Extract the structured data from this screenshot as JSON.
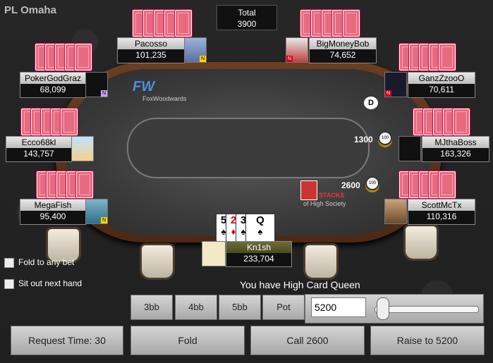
{
  "game": {
    "title": "PL Omaha"
  },
  "pot": {
    "label": "Total",
    "amount": "3900"
  },
  "players": {
    "pacosso": {
      "name": "Pacosso",
      "stack": "101,235"
    },
    "bigmoneybob": {
      "name": "BigMoneyBob",
      "stack": "74,652"
    },
    "pokergodgraz": {
      "name": "PokerGodGraz",
      "stack": "68,099"
    },
    "ganzzzooo": {
      "name": "GanzZzooO",
      "stack": "70,611"
    },
    "ecco68kl": {
      "name": "Ecco68kl",
      "stack": "143,757"
    },
    "mjthaboss": {
      "name": "MJthaBoss",
      "stack": "163,326"
    },
    "megafish": {
      "name": "MegaFish",
      "stack": "95,400"
    },
    "scottmctx": {
      "name": "ScottMcTx",
      "stack": "110,316"
    },
    "hero": {
      "name": "Kn1sh",
      "stack": "233,704"
    }
  },
  "badges": {
    "n": "N"
  },
  "bets": {
    "mjthaboss": "1300",
    "scottmctx": "2600",
    "chip_label": "100"
  },
  "dealer_button": "D",
  "table_logo": {
    "brand": "FW",
    "text": "FoxWoodwards"
  },
  "society_logo": {
    "word": "STACKS",
    "sub": "of High Society"
  },
  "hero_cards": [
    {
      "rank": "5",
      "suit": "♠",
      "color": "#000000"
    },
    {
      "rank": "2",
      "suit": "♦",
      "color": "#d0021b"
    },
    {
      "rank": "3",
      "suit": "♠",
      "color": "#000000"
    },
    {
      "rank": "Q",
      "suit": "♠",
      "color": "#000000"
    }
  ],
  "options": {
    "fold_to_any_bet": "Fold to any bet",
    "sit_out_next_hand": "Sit out next hand"
  },
  "hand_description": "You have High Card Queen",
  "quick_bets": {
    "b3": "3bb",
    "b4": "4bb",
    "b5": "5bb",
    "pot": "Pot"
  },
  "bet_input_value": "5200",
  "bet_slider_fraction": 0.02,
  "actions": {
    "request_time": "Request Time: 30",
    "fold": "Fold",
    "call": "Call 2600",
    "raise": "Raise to 5200"
  }
}
